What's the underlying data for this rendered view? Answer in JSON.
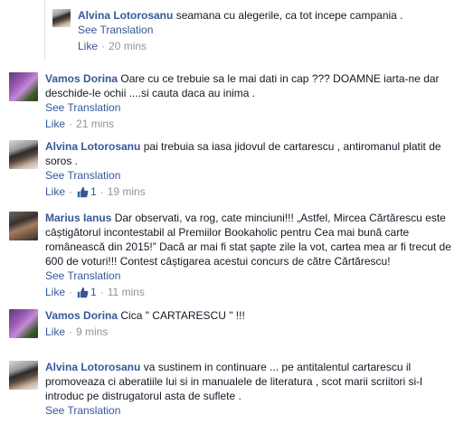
{
  "comments": [
    {
      "author": "Alvina Lotorosanu",
      "text": "seamana cu alegerile, ca tot incepe campania .",
      "see_translation": "See Translation",
      "like": "Like",
      "time": "20 mins",
      "likes": "",
      "reply": true
    },
    {
      "author": "Vamos Dorina",
      "text": "Oare cu ce trebuie sa le mai dati in cap ??? DOAMNE iarta-ne dar deschide-le ochii ....si cauta daca au inima .",
      "see_translation": "See Translation",
      "like": "Like",
      "time": "21 mins",
      "likes": ""
    },
    {
      "author": "Alvina Lotorosanu",
      "text": "pai trebuia sa iasa jidovul de cartarescu , antiromanul platit de soros .",
      "see_translation": "See Translation",
      "like": "Like",
      "time": "19 mins",
      "likes": "1"
    },
    {
      "author": "Marius Ianus",
      "text": "Dar observati, va rog, cate minciuni!!! „Astfel, Mircea Cărtărescu este câștigătorul incontestabil al Premiilor Bookaholic pentru Cea mai bună carte românească din 2015!” Dacă ar mai fi stat șapte zile la vot, cartea mea ar fi trecut de 600 de voturi!!! Contest câștigarea acestui concurs de către Cărtărescu!",
      "see_translation": "See Translation",
      "like": "Like",
      "time": "11 mins",
      "likes": "1"
    },
    {
      "author": "Vamos Dorina",
      "text": "Cica \" CARTARESCU \" !!!",
      "see_translation": "",
      "like": "Like",
      "time": "9 mins",
      "likes": ""
    },
    {
      "author": "Alvina Lotorosanu",
      "text": "va sustinem in continuare ... pe antitalentul cartarescu il promoveaza ci aberatiile lui si in manualele de literatura , scot marii scriitori si-l introduc pe distrugatorul asta de suflete .",
      "see_translation": "See Translation",
      "like": "",
      "time": "",
      "likes": ""
    }
  ],
  "separator": "·",
  "icons": {
    "like": "thumbs-up-icon"
  },
  "colors": {
    "link": "#365899",
    "meta": "#90949c",
    "text": "#141823"
  }
}
